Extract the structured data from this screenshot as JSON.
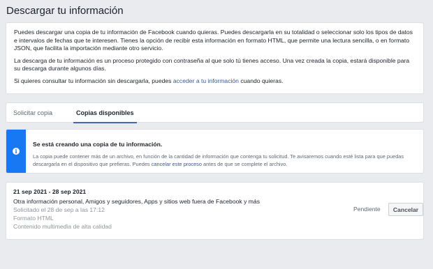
{
  "page": {
    "title": "Descargar tu información"
  },
  "intro": {
    "p1": "Puedes descargar una copia de tu información de Facebook cuando quieras. Puedes descargarla en su totalidad o seleccionar solo los tipos de datos e intervalos de fechas que te interesen. Tienes la opción de recibir esta información en formato HTML, que permite una lectura sencilla, o en formato JSON, que facilita la importación mediante otro servicio.",
    "p2": "La descarga de tu información es un proceso protegido con contraseña al que solo tú tienes acceso. Una vez creada la copia, estará disponible para su descarga durante algunos días.",
    "p3_before": "Si quieres consultar tu información sin descargarla, puedes ",
    "p3_link": "acceder a tu información",
    "p3_after": " cuando quieras."
  },
  "tabs": [
    {
      "label": "Solicitar copia",
      "active": false
    },
    {
      "label": "Copias disponibles",
      "active": true
    }
  ],
  "notice": {
    "icon": "info-icon",
    "icon_glyph": "i",
    "title": "Se está creando una copia de tu información.",
    "body_before": "La copia puede contener más de un archivo, en función de la cantidad de información que contenga tu solicitud. Te avisaremos cuando esté lista para que puedas descargarla en el dispositivo que prefieras. Puedes ",
    "body_link": "cancelar este proceso",
    "body_after": " antes de que se complete el archivo."
  },
  "copy": {
    "date_range": "21 sep 2021 - 28 sep 2021",
    "categories": "Otra información personal, Amigos y seguidores, Apps y sitios web fuera de Facebook y más",
    "requested": "Solicitado el 28 de sep a las 17:12",
    "format": "Formato HTML",
    "media_quality": "Contenido multimedia de alta calidad",
    "status": "Pendiente",
    "cancel_label": "Cancelar"
  },
  "colors": {
    "accent": "#1877f2",
    "link": "#385898",
    "background": "#e9ebee"
  }
}
